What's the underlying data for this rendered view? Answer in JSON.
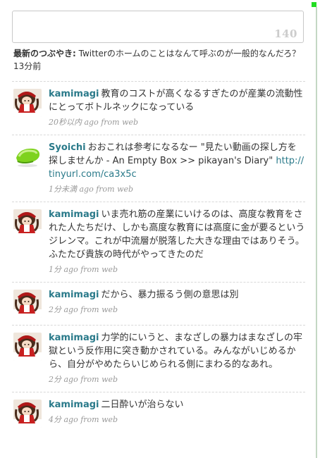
{
  "compose": {
    "counter": "140"
  },
  "latest": {
    "label": "最新のつぶやき:",
    "text": "Twitterのホームのことはなんて呼ぶのが一般的なんだろ？",
    "time": "13分前"
  },
  "tweets": [
    {
      "user": "kamimagi",
      "text": "教育のコストが高くなるすぎたのが産業の流動性にとってボトルネックになっている",
      "link": "",
      "time": "20秒以内 ago",
      "source": "from web",
      "avatar": "doll-avatar"
    },
    {
      "user": "Syoichi",
      "text": "おおこれは参考になるなー \"見たい動画の探し方を探しませんか - An Empty Box >> pikayan's Diary\" ",
      "link": "http://tinyurl.com/ca3x5c",
      "time": "1分未満 ago",
      "source": "from web",
      "avatar": "green-avatar"
    },
    {
      "user": "kamimagi",
      "text": "いま売れ筋の産業にいけるのは、高度な教育をされた人たちだけ、しかも高度な教育には高度に金が要るというジレンマ。これが中流層が脱落した大きな理由ではありそう。ふたたび貴族の時代がやってきたのだ",
      "link": "",
      "time": "1分 ago",
      "source": "from web",
      "avatar": "doll-avatar"
    },
    {
      "user": "kamimagi",
      "text": "だから、暴力振るう側の意思は別",
      "link": "",
      "time": "2分 ago",
      "source": "from web",
      "avatar": "doll-avatar"
    },
    {
      "user": "kamimagi",
      "text": "力学的にいうと、まなざしの暴力はまなざしの牢獄という反作用に突き動かされている。みんながいじめるから、自分がやめたらいじめられる側にまわる的なあれ。",
      "link": "",
      "time": "2分 ago",
      "source": "from web",
      "avatar": "doll-avatar"
    },
    {
      "user": "kamimagi",
      "text": "二日酔いが治らない",
      "link": "",
      "time": "4分 ago",
      "source": "from web",
      "avatar": "doll-avatar"
    }
  ],
  "colors": {
    "link": "#2a7a8a",
    "meta": "#999999",
    "counter": "#cccccc",
    "marker": "#22dd22"
  }
}
